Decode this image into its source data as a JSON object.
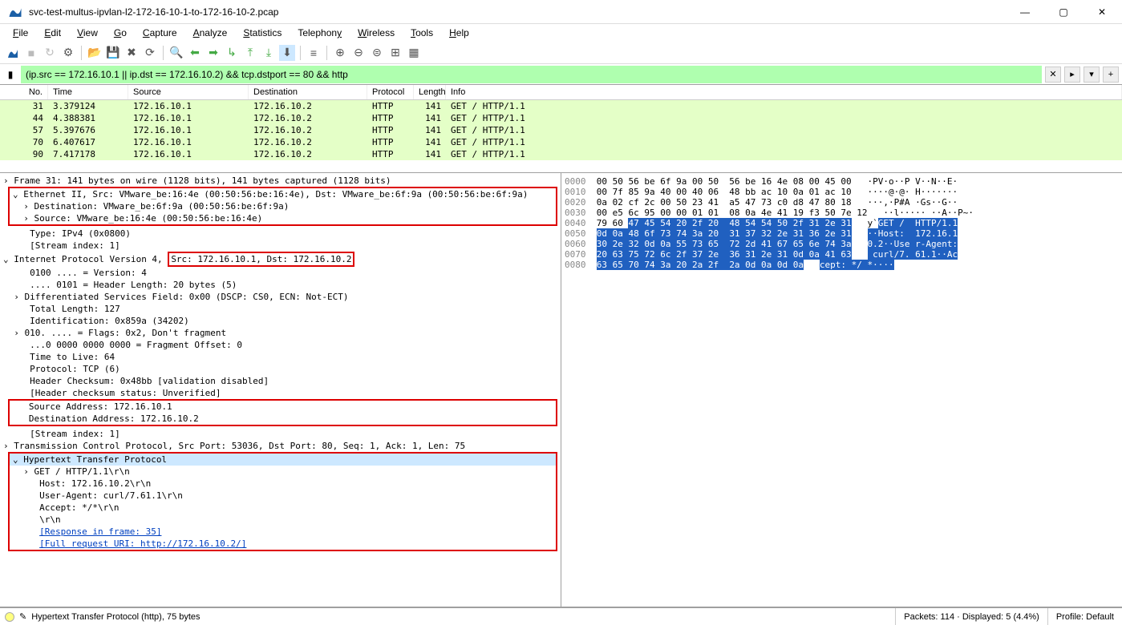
{
  "window": {
    "title": "svc-test-multus-ipvlan-l2-172-16-10-1-to-172-16-10-2.pcap"
  },
  "menu": {
    "file": "File",
    "edit": "Edit",
    "view": "View",
    "go": "Go",
    "capture": "Capture",
    "analyze": "Analyze",
    "statistics": "Statistics",
    "telephony": "Telephony",
    "wireless": "Wireless",
    "tools": "Tools",
    "help": "Help"
  },
  "filter": {
    "value": "(ip.src == 172.16.10.1 || ip.dst == 172.16.10.2) && tcp.dstport == 80 && http"
  },
  "columns": {
    "no": "No.",
    "time": "Time",
    "source": "Source",
    "destination": "Destination",
    "protocol": "Protocol",
    "length": "Length",
    "info": "Info"
  },
  "packets": [
    {
      "no": "31",
      "time": "3.379124",
      "src": "172.16.10.1",
      "dst": "172.16.10.2",
      "proto": "HTTP",
      "len": "141",
      "info": "GET / HTTP/1.1"
    },
    {
      "no": "44",
      "time": "4.388381",
      "src": "172.16.10.1",
      "dst": "172.16.10.2",
      "proto": "HTTP",
      "len": "141",
      "info": "GET / HTTP/1.1"
    },
    {
      "no": "57",
      "time": "5.397676",
      "src": "172.16.10.1",
      "dst": "172.16.10.2",
      "proto": "HTTP",
      "len": "141",
      "info": "GET / HTTP/1.1"
    },
    {
      "no": "70",
      "time": "6.407617",
      "src": "172.16.10.1",
      "dst": "172.16.10.2",
      "proto": "HTTP",
      "len": "141",
      "info": "GET / HTTP/1.1"
    },
    {
      "no": "90",
      "time": "7.417178",
      "src": "172.16.10.1",
      "dst": "172.16.10.2",
      "proto": "HTTP",
      "len": "141",
      "info": "GET / HTTP/1.1"
    }
  ],
  "details": {
    "frame": "Frame 31: 141 bytes on wire (1128 bits), 141 bytes captured (1128 bits)",
    "eth_hdr": "Ethernet II, Src: VMware_be:16:4e (00:50:56:be:16:4e), Dst: VMware_be:6f:9a (00:50:56:be:6f:9a)",
    "eth_dst": "Destination: VMware_be:6f:9a (00:50:56:be:6f:9a)",
    "eth_src": "Source: VMware_be:16:4e (00:50:56:be:16:4e)",
    "eth_type": "Type: IPv4 (0x0800)",
    "eth_stream": "[Stream index: 1]",
    "ip_hdr_pre": "Internet Protocol Version 4, ",
    "ip_hdr_box": "Src: 172.16.10.1, Dst: 172.16.10.2",
    "ip_ver": "0100 .... = Version: 4",
    "ip_hl": ".... 0101 = Header Length: 20 bytes (5)",
    "ip_dsf": "Differentiated Services Field: 0x00 (DSCP: CS0, ECN: Not-ECT)",
    "ip_tl": "Total Length: 127",
    "ip_id": "Identification: 0x859a (34202)",
    "ip_flags": "010. .... = Flags: 0x2, Don't fragment",
    "ip_frag": "...0 0000 0000 0000 = Fragment Offset: 0",
    "ip_ttl": "Time to Live: 64",
    "ip_proto": "Protocol: TCP (6)",
    "ip_cksum": "Header Checksum: 0x48bb [validation disabled]",
    "ip_cksum_status": "[Header checksum status: Unverified]",
    "ip_src": "Source Address: 172.16.10.1",
    "ip_dst": "Destination Address: 172.16.10.2",
    "ip_stream": "[Stream index: 1]",
    "tcp": "Transmission Control Protocol, Src Port: 53036, Dst Port: 80, Seq: 1, Ack: 1, Len: 75",
    "http": "Hypertext Transfer Protocol",
    "http_get": "GET / HTTP/1.1\\r\\n",
    "http_host": "Host: 172.16.10.2\\r\\n",
    "http_ua": "User-Agent: curl/7.61.1\\r\\n",
    "http_accept": "Accept: */*\\r\\n",
    "http_crlf": "\\r\\n",
    "http_resp": "[Response in frame: 35]",
    "http_uri": "[Full request URI: http://172.16.10.2/]"
  },
  "hex": {
    "rows": [
      {
        "off": "0000",
        "b": "00 50 56 be 6f 9a 00 50  56 be 16 4e 08 00 45 00",
        "a": "·PV·o··P V··N··E·"
      },
      {
        "off": "0010",
        "b": "00 7f 85 9a 40 00 40 06  48 bb ac 10 0a 01 ac 10",
        "a": "····@·@· H·······"
      },
      {
        "off": "0020",
        "b": "0a 02 cf 2c 00 50 23 41  a5 47 73 c0 d8 47 80 18",
        "a": "···,·P#A ·Gs··G··"
      },
      {
        "off": "0030",
        "b": "00 e5 6c 95 00 00 01 01  08 0a 4e 41 19 f3 50 7e 12",
        "a": "··l····· ··A··P~·"
      },
      {
        "off": "0040",
        "b": "79 60 ",
        "bsel": "47 45 54 20 2f 20  48 54 54 50 2f 31 2e 31",
        "a": "y`",
        "asel": "GET /  HTTP/1.1"
      },
      {
        "off": "0050",
        "bsel": "0d 0a 48 6f 73 74 3a 20  31 37 32 2e 31 36 2e 31",
        "asel": "··Host:  172.16.1"
      },
      {
        "off": "0060",
        "bsel": "30 2e 32 0d 0a 55 73 65  72 2d 41 67 65 6e 74 3a",
        "asel": "0.2··Use r-Agent:"
      },
      {
        "off": "0070",
        "bsel": "20 63 75 72 6c 2f 37 2e  36 31 2e 31 0d 0a 41 63",
        "asel": " curl/7. 61.1··Ac"
      },
      {
        "off": "0080",
        "bsel": "63 65 70 74 3a 20 2a 2f  2a 0d 0a 0d 0a",
        "asel": "cept: */ *····"
      }
    ]
  },
  "status": {
    "left": "Hypertext Transfer Protocol (http), 75 bytes",
    "mid": "Packets: 114 · Displayed: 5 (4.4%)",
    "right": "Profile: Default"
  }
}
